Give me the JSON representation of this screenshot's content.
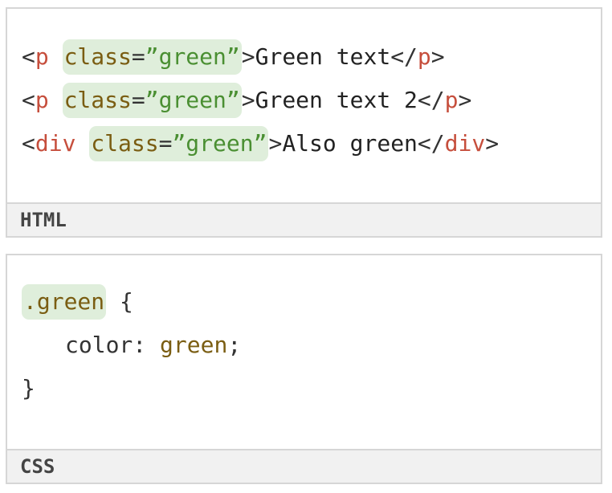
{
  "html_panel": {
    "label": "HTML",
    "line1": {
      "open_lt": "<",
      "tag": "p",
      "attr": "class",
      "eq": "=",
      "val": "”green”",
      "close_gt": ">",
      "text": "Green text",
      "end_lt": "</",
      "end_tag": "p",
      "end_gt": ">"
    },
    "line2": {
      "open_lt": "<",
      "tag": "p",
      "attr": "class",
      "eq": "=",
      "val": "”green”",
      "close_gt": ">",
      "text": "Green text 2",
      "end_lt": "</",
      "end_tag": "p",
      "end_gt": ">"
    },
    "line3": {
      "open_lt": "<",
      "tag": "div",
      "attr": "class",
      "eq": "=",
      "val": "”green”",
      "close_gt": ">",
      "text": "Also green",
      "end_lt": "</",
      "end_tag": "div",
      "end_gt": ">"
    }
  },
  "css_panel": {
    "label": "CSS",
    "selector": ".green",
    "open_brace": "{",
    "property": "color",
    "colon": ":",
    "value": "green",
    "semicolon": ";",
    "close_brace": "}"
  },
  "colors": {
    "tag": "#c64e3c",
    "attribute": "#7a5d12",
    "string": "#4a8f32",
    "highlight": "#dfeedb",
    "footer_bg": "#f1f1f1",
    "border": "#d6d6d6"
  }
}
